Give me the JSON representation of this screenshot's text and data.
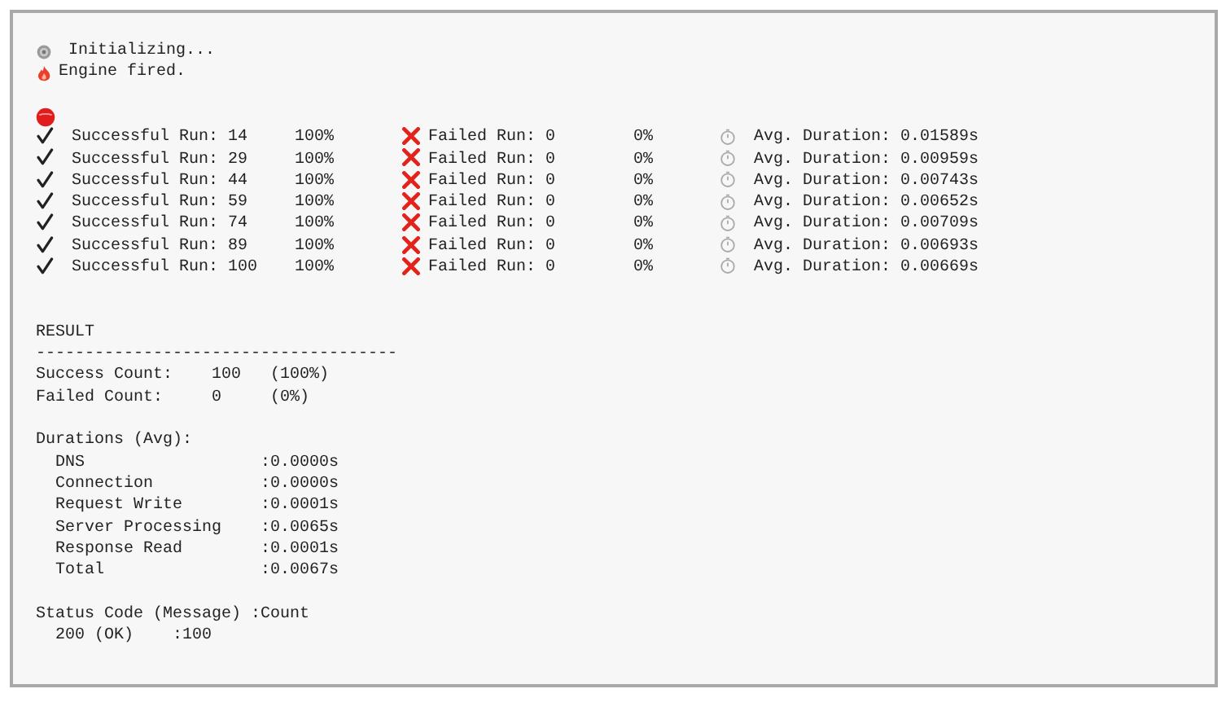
{
  "log": [
    {
      "kind": "gear",
      "text": "Initializing..."
    },
    {
      "kind": "fire",
      "text": "Engine fired."
    }
  ],
  "runs": [
    {
      "success": "Successful Run: 14",
      "success_pct": "100%",
      "failed": "Failed Run: 0",
      "failed_pct": "0%",
      "duration": "Avg. Duration: 0.01589s"
    },
    {
      "success": "Successful Run: 29",
      "success_pct": "100%",
      "failed": "Failed Run: 0",
      "failed_pct": "0%",
      "duration": "Avg. Duration: 0.00959s"
    },
    {
      "success": "Successful Run: 44",
      "success_pct": "100%",
      "failed": "Failed Run: 0",
      "failed_pct": "0%",
      "duration": "Avg. Duration: 0.00743s"
    },
    {
      "success": "Successful Run: 59",
      "success_pct": "100%",
      "failed": "Failed Run: 0",
      "failed_pct": "0%",
      "duration": "Avg. Duration: 0.00652s"
    },
    {
      "success": "Successful Run: 74",
      "success_pct": "100%",
      "failed": "Failed Run: 0",
      "failed_pct": "0%",
      "duration": "Avg. Duration: 0.00709s"
    },
    {
      "success": "Successful Run: 89",
      "success_pct": "100%",
      "failed": "Failed Run: 0",
      "failed_pct": "0%",
      "duration": "Avg. Duration: 0.00693s"
    },
    {
      "success": "Successful Run: 100",
      "success_pct": "100%",
      "failed": "Failed Run: 0",
      "failed_pct": "0%",
      "duration": "Avg. Duration: 0.00669s"
    }
  ],
  "result": {
    "title": "RESULT",
    "rule": "-------------------------------------",
    "counts": [
      {
        "label": "Success Count:",
        "value": "100",
        "pct": "(100%)"
      },
      {
        "label": "Failed Count:",
        "value": "0",
        "pct": "(0%)"
      }
    ],
    "durations_title": "Durations (Avg):",
    "durations": [
      {
        "label": "DNS",
        "value": ":0.0000s"
      },
      {
        "label": "Connection",
        "value": ":0.0000s"
      },
      {
        "label": "Request Write",
        "value": ":0.0001s"
      },
      {
        "label": "Server Processing",
        "value": ":0.0065s"
      },
      {
        "label": "Response Read",
        "value": ":0.0001s"
      },
      {
        "label": "Total",
        "value": ":0.0067s"
      }
    ],
    "status_title": "Status Code (Message) :Count",
    "status_codes": [
      {
        "code": "200 (OK)",
        "count": ":100"
      }
    ]
  }
}
